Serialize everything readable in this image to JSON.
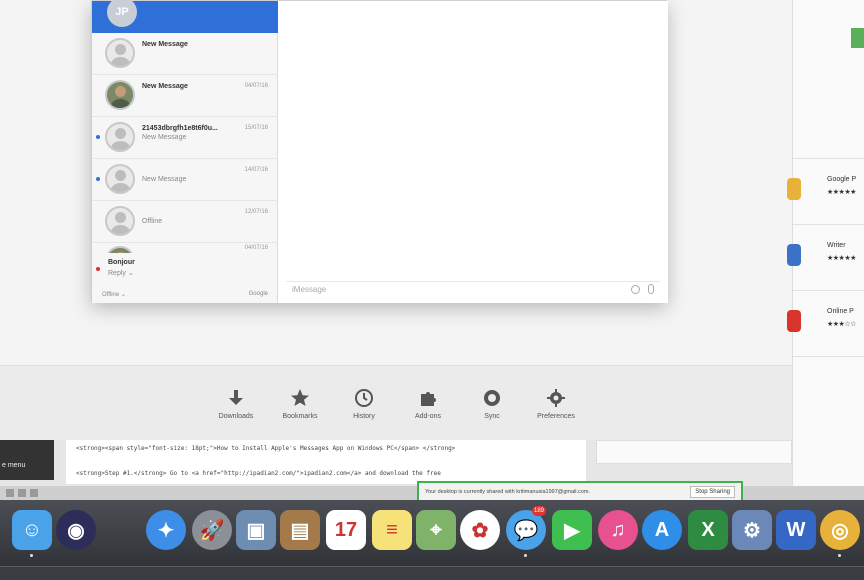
{
  "messages_app": {
    "active_conversation": {
      "initials": "JP"
    },
    "conversations": [
      {
        "title": "New Message",
        "subtitle": "",
        "date": "",
        "unread": false,
        "photo": false
      },
      {
        "title": "New Message",
        "subtitle": "",
        "date": "04/07/16",
        "unread": false,
        "photo": true
      },
      {
        "title": "21453dbrgfh1e8t6f0u...",
        "subtitle": "New Message",
        "date": "15/07/16",
        "unread": true,
        "photo": false
      },
      {
        "title": "",
        "subtitle": "New Message",
        "date": "14/07/16",
        "unread": true,
        "photo": false
      },
      {
        "title": "",
        "subtitle": "Offline",
        "date": "12/07/16",
        "unread": false,
        "photo": false
      },
      {
        "title": "",
        "subtitle": "",
        "date": "04/07/16",
        "unread": false,
        "photo": true
      }
    ],
    "current_status": {
      "name": "Bonjour",
      "state": "Reply ⌄"
    },
    "footer": {
      "status": "Offline ⌄",
      "account": "Google"
    },
    "input_placeholder": "iMessage"
  },
  "browser_toolbar": {
    "items": [
      {
        "label": "Downloads",
        "icon": "download-icon"
      },
      {
        "label": "Bookmarks",
        "icon": "star-icon"
      },
      {
        "label": "History",
        "icon": "clock-icon"
      },
      {
        "label": "Add-ons",
        "icon": "puzzle-icon"
      },
      {
        "label": "Sync",
        "icon": "sync-icon"
      },
      {
        "label": "Preferences",
        "icon": "gear-icon"
      }
    ]
  },
  "right_panel": {
    "apps": [
      {
        "name": "Google P",
        "rating": "★★★★★",
        "badge_color": "#e8b13a"
      },
      {
        "name": "Writer",
        "rating": "★★★★★",
        "badge_color": "#3b72c7"
      },
      {
        "name": "Online P",
        "rating": "★★★☆☆",
        "badge_color": "#d9342b"
      }
    ]
  },
  "editor": {
    "sidebar_text": "e menu",
    "lines": [
      "<strong><span style=\"font-size: 18pt;\">How to Install Apple's Messages App on Windows PC</span> </strong>",
      "<strong>Step #1.</strong> Go to <a href=\"http://ipadian2.com/\">ipadian2.com</a> and download the free"
    ]
  },
  "screen_share": {
    "message": "Your desktop is currently shared with kritimanusia1997@gmail.com.",
    "stop_label": "Stop Sharing"
  },
  "dock": {
    "apps": [
      {
        "name": "finder-icon",
        "color": "#4aa3e8",
        "glyph": "☺",
        "round": false,
        "dot": true
      },
      {
        "name": "siri-icon",
        "color": "#2d2d5a",
        "glyph": "◉",
        "round": true,
        "dot": false
      },
      {
        "name": "safari-icon",
        "color": "#3d8ee6",
        "glyph": "✦",
        "round": true,
        "dot": false
      },
      {
        "name": "launchpad-icon",
        "color": "#8b8f96",
        "glyph": "🚀",
        "round": true,
        "dot": false
      },
      {
        "name": "preview-icon",
        "color": "#6d8db3",
        "glyph": "▣",
        "round": false,
        "dot": false
      },
      {
        "name": "contacts-icon",
        "color": "#a47a4a",
        "glyph": "▤",
        "round": false,
        "dot": false
      },
      {
        "name": "calendar-icon",
        "color": "#ffffff",
        "glyph": "17",
        "round": false,
        "dot": false
      },
      {
        "name": "notes-icon",
        "color": "#f7e27a",
        "glyph": "≡",
        "round": false,
        "dot": false
      },
      {
        "name": "maps-icon",
        "color": "#7fb36a",
        "glyph": "⌖",
        "round": false,
        "dot": false
      },
      {
        "name": "photos-icon",
        "color": "#ffffff",
        "glyph": "✿",
        "round": true,
        "dot": false
      },
      {
        "name": "messages-icon",
        "color": "#4aa3e8",
        "glyph": "💬",
        "round": true,
        "dot": true
      },
      {
        "name": "facetime-icon",
        "color": "#3fbf4f",
        "glyph": "▶",
        "round": false,
        "dot": false
      },
      {
        "name": "itunes-icon",
        "color": "#e8518f",
        "glyph": "♫",
        "round": true,
        "dot": false
      },
      {
        "name": "app-store-icon",
        "color": "#2f8fe8",
        "glyph": "A",
        "round": true,
        "dot": false
      },
      {
        "name": "excel-icon",
        "color": "#2e8b42",
        "glyph": "X",
        "round": false,
        "dot": false
      },
      {
        "name": "system-preferences-icon",
        "color": "#6b89b8",
        "glyph": "⚙",
        "round": false,
        "dot": false
      },
      {
        "name": "word-icon",
        "color": "#3568c4",
        "glyph": "W",
        "round": false,
        "dot": false
      },
      {
        "name": "chrome-icon",
        "color": "#e8b13a",
        "glyph": "◎",
        "round": true,
        "dot": true
      }
    ],
    "badge_count": "189"
  }
}
